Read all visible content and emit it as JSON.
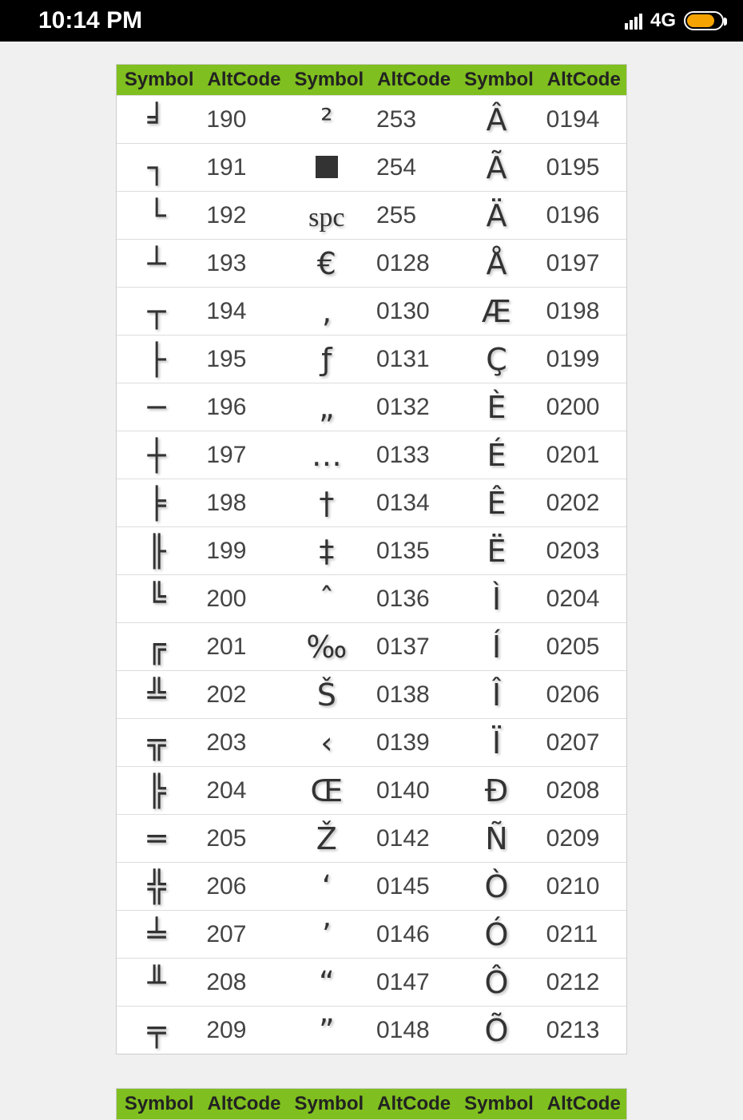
{
  "status": {
    "time": "10:14 PM",
    "network": "4G"
  },
  "headers": [
    "Symbol",
    "AltCode",
    "Symbol",
    "AltCode",
    "Symbol",
    "AltCode"
  ],
  "tables": [
    {
      "rows": [
        {
          "s1": "╛",
          "c1": "190",
          "s2": "²",
          "c2": "253",
          "s3": "Â",
          "c3": "0194"
        },
        {
          "s1": "┐",
          "c1": "191",
          "s2": "■",
          "c2": "254",
          "s3": "Ã",
          "c3": "0195"
        },
        {
          "s1": "└",
          "c1": "192",
          "s2": "spc",
          "c2": "255",
          "s3": "Ä",
          "c3": "0196"
        },
        {
          "s1": "┴",
          "c1": "193",
          "s2": "€",
          "c2": "0128",
          "s3": "Å",
          "c3": "0197"
        },
        {
          "s1": "┬",
          "c1": "194",
          "s2": "‚",
          "c2": "0130",
          "s3": "Æ",
          "c3": "0198"
        },
        {
          "s1": "├",
          "c1": "195",
          "s2": "ƒ",
          "c2": "0131",
          "s3": "Ç",
          "c3": "0199"
        },
        {
          "s1": "─",
          "c1": "196",
          "s2": "„",
          "c2": "0132",
          "s3": "È",
          "c3": "0200"
        },
        {
          "s1": "┼",
          "c1": "197",
          "s2": "…",
          "c2": "0133",
          "s3": "É",
          "c3": "0201"
        },
        {
          "s1": "╞",
          "c1": "198",
          "s2": "†",
          "c2": "0134",
          "s3": "Ê",
          "c3": "0202"
        },
        {
          "s1": "╟",
          "c1": "199",
          "s2": "‡",
          "c2": "0135",
          "s3": "Ë",
          "c3": "0203"
        },
        {
          "s1": "╚",
          "c1": "200",
          "s2": "ˆ",
          "c2": "0136",
          "s3": "Ì",
          "c3": "0204"
        },
        {
          "s1": "╔",
          "c1": "201",
          "s2": "‰",
          "c2": "0137",
          "s3": "Í",
          "c3": "0205"
        },
        {
          "s1": "╩",
          "c1": "202",
          "s2": "Š",
          "c2": "0138",
          "s3": "Î",
          "c3": "0206"
        },
        {
          "s1": "╦",
          "c1": "203",
          "s2": "‹",
          "c2": "0139",
          "s3": "Ï",
          "c3": "0207"
        },
        {
          "s1": "╠",
          "c1": "204",
          "s2": "Œ",
          "c2": "0140",
          "s3": "Ð",
          "c3": "0208"
        },
        {
          "s1": "═",
          "c1": "205",
          "s2": "Ž",
          "c2": "0142",
          "s3": "Ñ",
          "c3": "0209"
        },
        {
          "s1": "╬",
          "c1": "206",
          "s2": "‘",
          "c2": "0145",
          "s3": "Ò",
          "c3": "0210"
        },
        {
          "s1": "╧",
          "c1": "207",
          "s2": "’",
          "c2": "0146",
          "s3": "Ó",
          "c3": "0211"
        },
        {
          "s1": "╨",
          "c1": "208",
          "s2": "“",
          "c2": "0147",
          "s3": "Ô",
          "c3": "0212"
        },
        {
          "s1": "╤",
          "c1": "209",
          "s2": "”",
          "c2": "0148",
          "s3": "Õ",
          "c3": "0213"
        }
      ]
    },
    {
      "rows": []
    }
  ]
}
